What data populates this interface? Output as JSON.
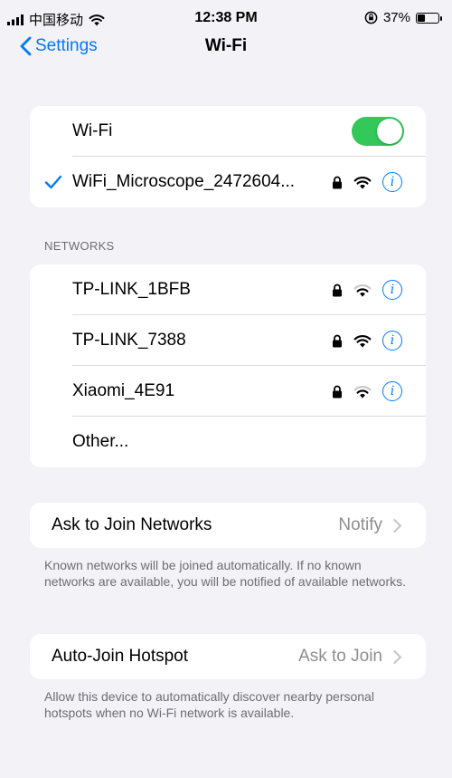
{
  "status_bar": {
    "carrier": "中国移动",
    "time": "12:38 PM",
    "battery_percent": "37%",
    "battery_level": 0.37
  },
  "nav": {
    "back_label": "Settings",
    "title": "Wi-Fi"
  },
  "wifi": {
    "toggle_label": "Wi-Fi",
    "toggle_on": true,
    "connected_network": "WiFi_Microscope_2472604..."
  },
  "networks": {
    "header": "NETWORKS",
    "items": [
      {
        "name": "TP-LINK_1BFB"
      },
      {
        "name": "TP-LINK_7388"
      },
      {
        "name": "Xiaomi_4E91"
      }
    ],
    "other_label": "Other..."
  },
  "ask_to_join": {
    "label": "Ask to Join Networks",
    "value": "Notify",
    "footer": "Known networks will be joined automatically. If no known networks are available, you will be notified of available networks."
  },
  "auto_join": {
    "label": "Auto-Join Hotspot",
    "value": "Ask to Join",
    "footer": "Allow this device to automatically discover nearby personal hotspots when no Wi-Fi network is available."
  },
  "colors": {
    "accent": "#007aff",
    "toggle_on": "#34c759",
    "background": "#f2f2f7"
  },
  "icons": [
    "signal-bars-icon",
    "wifi-icon",
    "orientation-lock-icon",
    "battery-icon",
    "chevron-left-icon",
    "checkmark-icon",
    "lock-icon",
    "info-icon",
    "chevron-right-icon"
  ]
}
